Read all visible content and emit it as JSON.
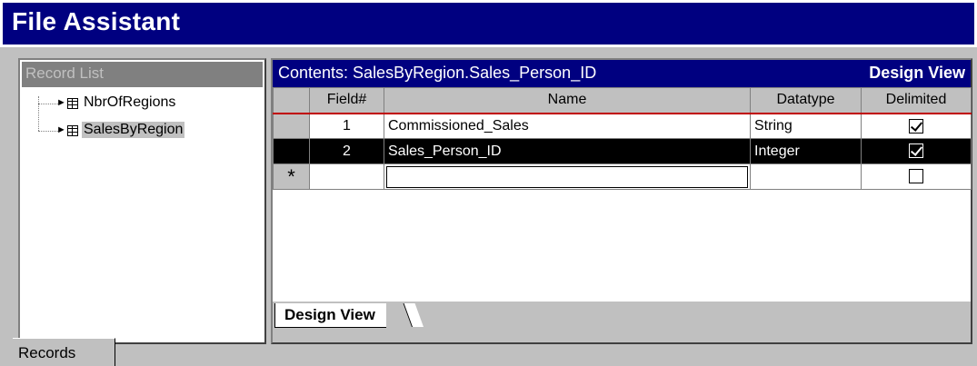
{
  "window": {
    "title": "File Assistant"
  },
  "record_list": {
    "header": "Record List",
    "items": [
      {
        "label": "NbrOfRegions",
        "selected": false
      },
      {
        "label": "SalesByRegion",
        "selected": true
      }
    ]
  },
  "contents": {
    "header_left": "Contents: SalesByRegion.Sales_Person_ID",
    "header_right": "Design View",
    "columns": [
      "",
      "Field#",
      "Name",
      "Datatype",
      "Delimited"
    ],
    "rows": [
      {
        "field_no": "1",
        "name": "Commissioned_Sales",
        "datatype": "String",
        "delimited": true,
        "selected": false
      },
      {
        "field_no": "2",
        "name": "Sales_Person_ID",
        "datatype": "Integer",
        "delimited": true,
        "selected": true
      }
    ],
    "new_row_marker": "*",
    "new_row_delimited": false
  },
  "tabs": {
    "design_view": "Design View"
  },
  "bottom_tabs": {
    "records": "Records"
  },
  "colors": {
    "title_bg": "#000080",
    "header_bg": "#000080",
    "selected_row": "#000000",
    "panel_bg": "#c0c0c0"
  },
  "icons": {
    "tree_item": "table-icon",
    "tree_arrow": "arrow-right-icon"
  }
}
